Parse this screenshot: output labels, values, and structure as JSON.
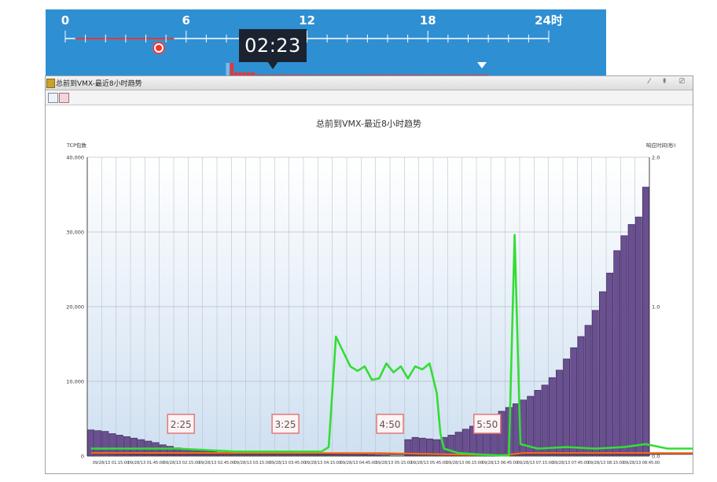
{
  "timeline": {
    "tick_labels": [
      "0",
      "6",
      "12",
      "18",
      "24时"
    ],
    "current_time": "02:23"
  },
  "window": {
    "title": "总前到VMX-最近8小时趋势",
    "controls": "⁄ ⇞ ⎚"
  },
  "chart_data": {
    "type": "bar",
    "title": "总前到VMX-最近8小时趋势",
    "ylabel": "TCP包数",
    "y2label": "响应时间(秒)",
    "ylim": [
      0,
      40000
    ],
    "y2lim": [
      0,
      2.0
    ],
    "y_ticks": [
      "0",
      "10,000",
      "20,000",
      "30,000",
      "40,000"
    ],
    "y2_ticks": [
      "0.0",
      "1.0",
      "2.0"
    ],
    "x_tick_labels": [
      "09/28/13 01:15:00",
      "09/28/13 01:45:00",
      "09/28/13 02:15:00",
      "09/28/13 02:45:00",
      "09/28/13 03:15:00",
      "09/28/13 03:45:00",
      "09/28/13 04:15:00",
      "09/28/13 04:45:00",
      "09/28/13 05:15:00",
      "09/28/13 05:45:00",
      "09/28/13 06:15:00",
      "09/28/13 06:45:00",
      "09/28/13 07:15:00",
      "09/28/13 07:45:00",
      "09/28/13 08:15:00",
      "09/28/13 08:45:00"
    ],
    "grid": true,
    "colors": {
      "bars": "#6a4f91",
      "bar_top": "#3f2c5c",
      "response": "#33dd33",
      "series3": "#ff6a1a",
      "series4": "#3a2a3a"
    },
    "bars": [
      3500,
      3400,
      3300,
      3000,
      2800,
      2600,
      2400,
      2200,
      2000,
      1800,
      1500,
      1300,
      1100,
      950,
      800,
      700,
      650,
      600,
      500,
      500,
      450,
      420,
      400,
      400,
      380,
      380,
      360,
      350,
      350,
      340,
      330,
      320,
      300,
      280,
      260,
      240,
      220,
      200,
      150,
      100,
      80,
      60,
      0,
      0,
      2200,
      2500,
      2400,
      2300,
      2200,
      2500,
      2800,
      3200,
      3600,
      4000,
      4500,
      5000,
      5500,
      6000,
      6500,
      7000,
      7500,
      8000,
      8800,
      9500,
      10500,
      11500,
      13000,
      14500,
      16000,
      17500,
      19500,
      22000,
      24500,
      27500,
      29500,
      31000,
      32000,
      36000
    ],
    "response_time": [
      [
        0,
        0.05
      ],
      [
        4,
        0.05
      ],
      [
        8,
        0.05
      ],
      [
        12,
        0.05
      ],
      [
        16,
        0.04
      ],
      [
        20,
        0.03
      ],
      [
        24,
        0.03
      ],
      [
        28,
        0.03
      ],
      [
        32,
        0.03
      ],
      [
        33,
        0.06
      ],
      [
        34,
        0.8
      ],
      [
        35,
        0.7
      ],
      [
        36,
        0.6
      ],
      [
        37,
        0.57
      ],
      [
        38,
        0.6
      ],
      [
        39,
        0.51
      ],
      [
        40,
        0.52
      ],
      [
        41,
        0.62
      ],
      [
        42,
        0.56
      ],
      [
        43,
        0.6
      ],
      [
        44,
        0.52
      ],
      [
        45,
        0.6
      ],
      [
        46,
        0.58
      ],
      [
        47,
        0.62
      ],
      [
        48,
        0.42
      ],
      [
        48.5,
        0.15
      ],
      [
        49,
        0.05
      ],
      [
        51,
        0.02
      ],
      [
        54,
        0.01
      ],
      [
        57,
        0.005
      ],
      [
        58,
        0.005
      ],
      [
        58.8,
        1.48
      ],
      [
        59.6,
        0.08
      ],
      [
        62,
        0.05
      ],
      [
        66,
        0.06
      ],
      [
        70,
        0.05
      ],
      [
        74,
        0.06
      ],
      [
        77,
        0.08
      ],
      [
        80,
        0.05
      ],
      [
        84,
        0.05
      ],
      [
        88,
        0.05
      ],
      [
        92,
        0.05
      ],
      [
        96,
        0.05
      ]
    ],
    "series3": [
      [
        0,
        0.02
      ],
      [
        20,
        0.02
      ],
      [
        40,
        0.02
      ],
      [
        57,
        0.005
      ],
      [
        60,
        0.02
      ],
      [
        80,
        0.02
      ],
      [
        96,
        0.02
      ]
    ],
    "series4": [
      [
        0,
        0.015
      ],
      [
        10,
        0.01
      ],
      [
        20,
        0.012
      ],
      [
        30,
        0.012
      ],
      [
        45,
        0.01
      ],
      [
        57,
        0.005
      ],
      [
        60,
        0.012
      ],
      [
        80,
        0.012
      ],
      [
        96,
        0.012
      ]
    ],
    "annotations": [
      {
        "text": "2:25",
        "x": 12.5
      },
      {
        "text": "3:25",
        "x": 27.0
      },
      {
        "text": "4:50",
        "x": 41.5
      },
      {
        "text": "5:50",
        "x": 55.0
      }
    ]
  }
}
